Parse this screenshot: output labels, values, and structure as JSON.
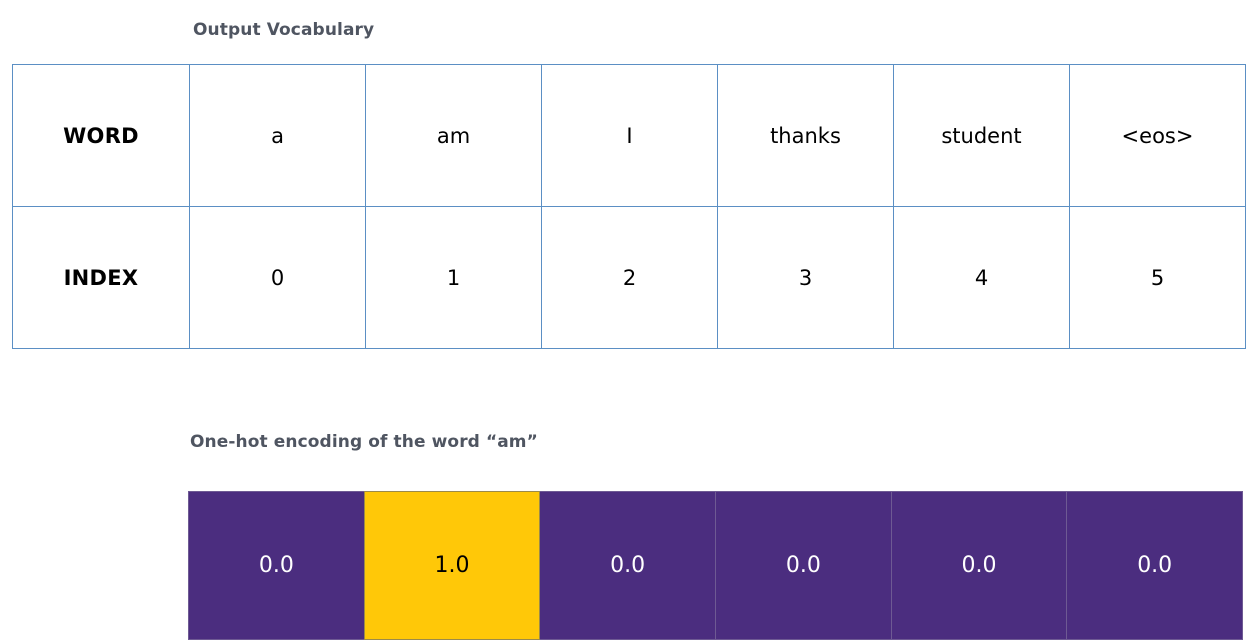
{
  "vocabulary_section": {
    "caption": "Output Vocabulary",
    "rows": [
      {
        "label": "WORD",
        "cells": [
          "a",
          "am",
          "I",
          "thanks",
          "student",
          "<eos>"
        ]
      },
      {
        "label": "INDEX",
        "cells": [
          "0",
          "1",
          "2",
          "3",
          "4",
          "5"
        ]
      }
    ]
  },
  "onehot_section": {
    "caption": "One-hot encoding of the word “am”",
    "highlight_index": 1,
    "cells": [
      {
        "value": "0.0",
        "state": "off"
      },
      {
        "value": "1.0",
        "state": "on"
      },
      {
        "value": "0.0",
        "state": "off"
      },
      {
        "value": "0.0",
        "state": "off"
      },
      {
        "value": "0.0",
        "state": "off"
      },
      {
        "value": "0.0",
        "state": "off"
      }
    ]
  },
  "colors": {
    "caption_text": "#4f5561",
    "table_border": "#5b8fc4",
    "onehot_off_fill": "#4b2d7f",
    "onehot_on_fill": "#ffc808",
    "onehot_off_text": "#ffffff",
    "onehot_on_text": "#000000",
    "background": "#ffffff"
  }
}
